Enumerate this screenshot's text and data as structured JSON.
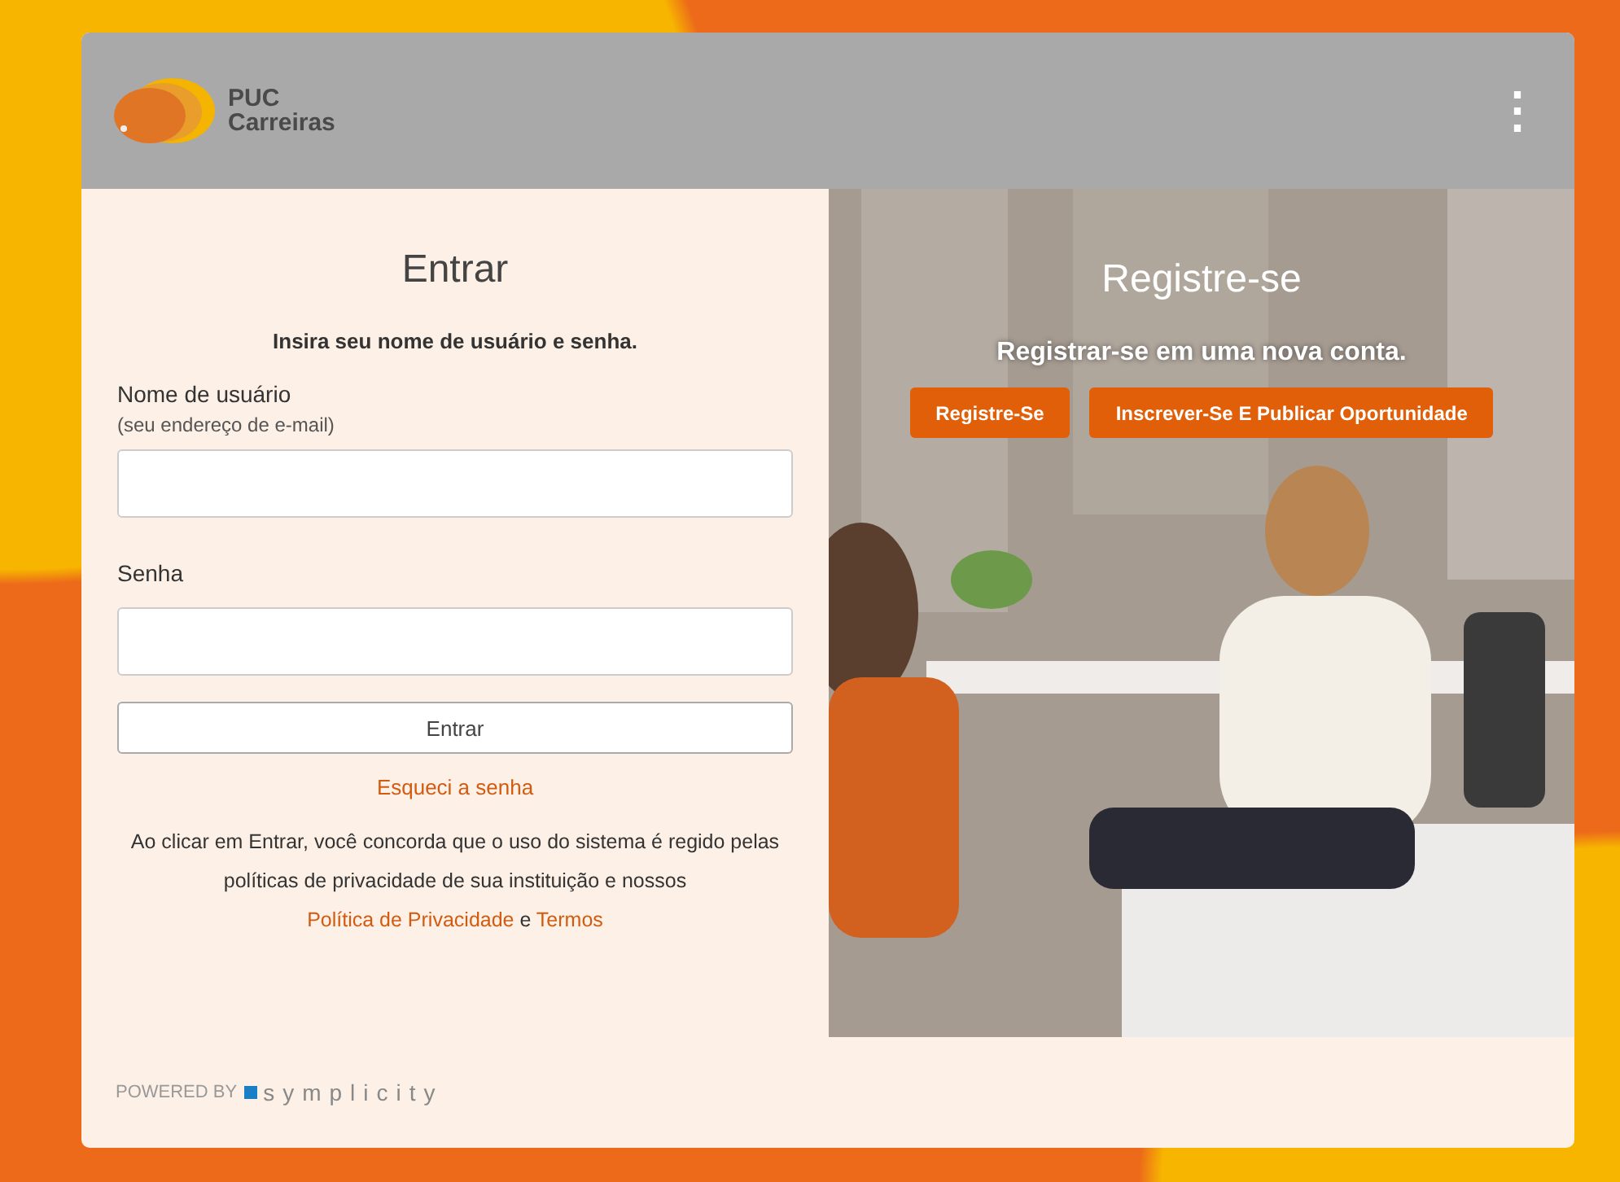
{
  "header": {
    "brand_line_1": "PUC",
    "brand_line_2": "Carreiras",
    "menu_icon": "⋮"
  },
  "login": {
    "title": "Entrar",
    "subtitle": "Insira seu nome de usuário e senha.",
    "fields": [
      {
        "label": "Nome de usuário",
        "hint": "(seu endereço de e-mail)"
      },
      {
        "label": "Senha"
      }
    ],
    "button": "Entrar",
    "forgot_link": "Esqueci a senha",
    "legal": [
      {
        "kind": "text",
        "text": "Ao clicar em Entrar, você concorda que o uso do sistema é regido pelas políticas de privacidade de sua instituição e nossos "
      },
      {
        "kind": "link",
        "text": "Política de Privacidade"
      },
      {
        "kind": "text",
        "text": " e "
      },
      {
        "kind": "link",
        "text": "Termos"
      }
    ]
  },
  "register": {
    "title": "Registre-se",
    "subtitle": "Registrar-se em uma nova conta.",
    "buttons": [
      "Registre-Se",
      "Inscrever-Se E Publicar Oportunidade"
    ]
  },
  "footer": {
    "powered_by": "POWERED BY",
    "brand": "symplicity"
  }
}
